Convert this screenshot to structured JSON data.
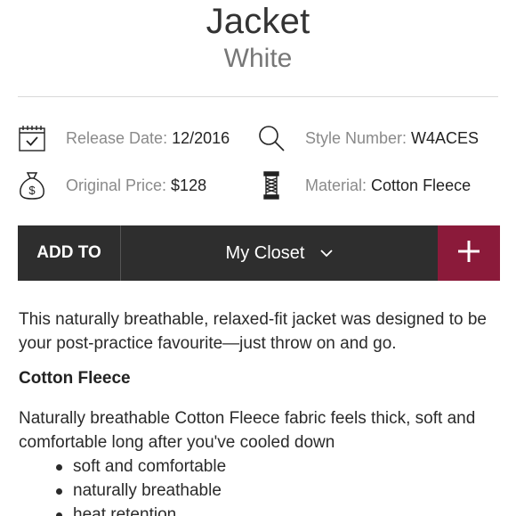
{
  "product": {
    "name": "Jacket",
    "color": "White"
  },
  "attributes": {
    "release_date": {
      "label": "Release Date:",
      "value": "12/2016",
      "icon": "calendar-icon"
    },
    "style_number": {
      "label": "Style Number:",
      "value": "W4ACES",
      "icon": "search-icon"
    },
    "original_price": {
      "label": "Original Price:",
      "value": "$128",
      "icon": "money-bag-icon"
    },
    "material": {
      "label": "Material:",
      "value": "Cotton Fleece",
      "icon": "thread-spool-icon"
    }
  },
  "add_bar": {
    "add_to_label": "ADD TO",
    "closet_selected": "My Closet",
    "plus_symbol": "+",
    "accent_color": "#8b1a3a",
    "bar_color": "#2e2e2e"
  },
  "description": {
    "intro": "This naturally breathable, relaxed-fit jacket was designed to be your post-practice favourite—just throw on and go.",
    "section_title": "Cotton Fleece",
    "section_text": "Naturally breathable Cotton Fleece fabric feels thick, soft and comfortable long after you've cooled down",
    "features": [
      "soft and comfortable",
      "naturally breathable",
      "heat retention"
    ]
  }
}
